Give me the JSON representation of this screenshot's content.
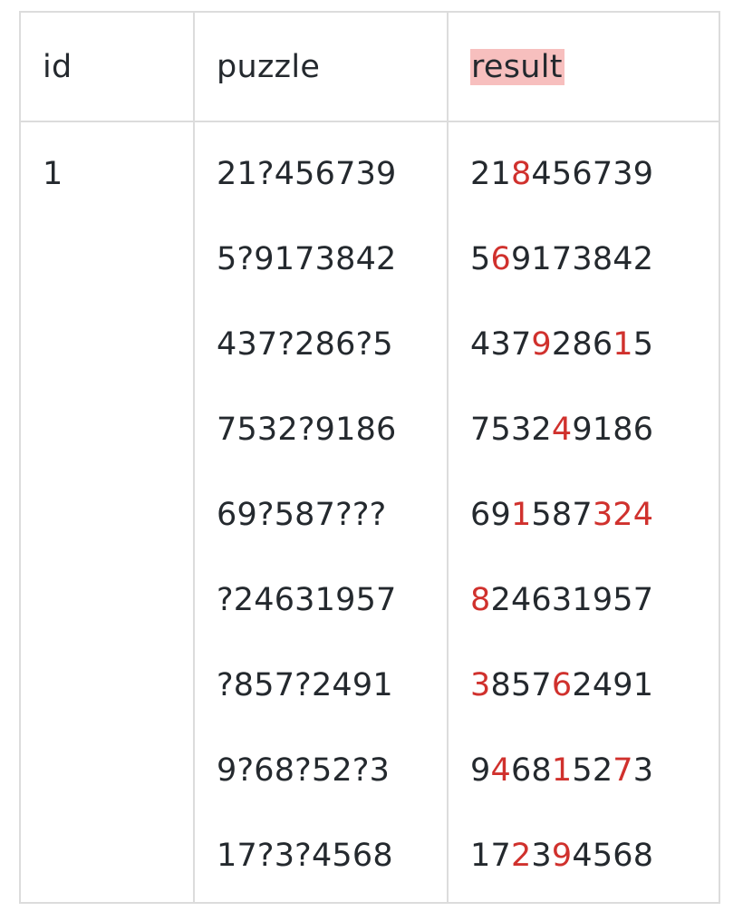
{
  "table": {
    "headers": [
      "id",
      "puzzle",
      "result"
    ],
    "highlighted_header": "result",
    "colors": {
      "highlight_bg": "#f7bfbe",
      "filled_digit": "#d0312d",
      "text": "#24292e",
      "border": "#dcdcdc"
    },
    "rows": [
      {
        "id": "1",
        "puzzle": [
          "21?456739",
          "5?9173842",
          "437?286?5",
          "7532?9186",
          "69?587???",
          "?24631957",
          "?857?2491",
          "9?68?52?3",
          "17?3?4568"
        ],
        "result": [
          "218456739",
          "569173842",
          "437928615",
          "753249186",
          "691587324",
          "824631957",
          "385762491",
          "946815273",
          "172394568"
        ]
      }
    ]
  }
}
